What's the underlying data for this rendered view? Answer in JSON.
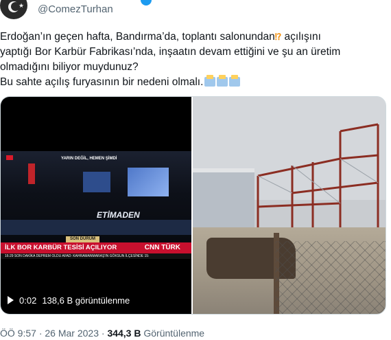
{
  "header": {
    "handle": "@ComezTurhan"
  },
  "tweet": {
    "lines": [
      "Erdoğan’ın geçen hafta, Bandırma’da, toplantı salonundan",
      "yaptığı Bor Karbür Fabrikası’nda, inşaatın devam ettiğini ve şu an üretim",
      "olmadığını biliyor muydunuz?",
      "Bu sahte açılış furyasının bir nedeni olmalı."
    ],
    "line1_suffix": " açılışını",
    "exclamation_emoji": "⁉",
    "emoji_names": [
      "exclamation-question-icon",
      "ballot-box-icon"
    ]
  },
  "video": {
    "time": "0:02",
    "views": "138,6 B görüntülenme",
    "stage_text": "YARIN DEĞİL, HEMEN ŞİMDİ",
    "stage_logo": "ETİMADEN",
    "son_durum": "SON DURUM",
    "headline": "İLK BOR KARBÜR TESİSİ AÇILIYOR",
    "channel_logo": "CNN TÜRK",
    "ticker": "16:29  SON DAKİKA  DEPREM OLDU    AFAD: KAHRAMANMARAŞ'IN GÖKSUN İLÇESİNDE 15:"
  },
  "footer": {
    "time": "ÖÖ 9:57",
    "separator": "·",
    "date": "26 Mar 2023",
    "views_count": "344,3 B",
    "views_label": "Görüntülenme"
  },
  "colors": {
    "text": "#0f1419",
    "muted": "#536471",
    "verified": "#1d9bf0",
    "news_red": "#c8102e"
  }
}
